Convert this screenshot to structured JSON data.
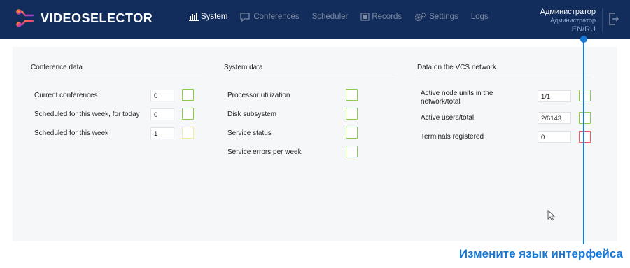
{
  "app": {
    "name": "VIDEOSELECTOR"
  },
  "nav": [
    {
      "label": "System",
      "icon": "bar-chart-icon",
      "active": true
    },
    {
      "label": "Conferences",
      "icon": "chat-bubble-icon"
    },
    {
      "label": "Scheduler",
      "icon": ""
    },
    {
      "label": "Records",
      "icon": "film-icon"
    },
    {
      "label": "Settings",
      "icon": "gears-icon"
    },
    {
      "label": "Logs",
      "icon": ""
    }
  ],
  "user": {
    "name": "Администратор",
    "role": "Администратор",
    "language": "EN/RU"
  },
  "conference_data": {
    "title": "Conference data",
    "rows": [
      {
        "label": "Current conferences",
        "value": "0",
        "status": "green"
      },
      {
        "label": "Scheduled for this week, for today",
        "value": "0",
        "status": "green"
      },
      {
        "label": "Scheduled for this week",
        "value": "1",
        "status": "yellow"
      }
    ]
  },
  "system_data": {
    "title": "System data",
    "rows": [
      {
        "label": "Processor utilization",
        "status": "green"
      },
      {
        "label": "Disk subsystem",
        "status": "green"
      },
      {
        "label": "Service status",
        "status": "green"
      },
      {
        "label": "Service errors per week",
        "status": "green"
      }
    ]
  },
  "vcs_network": {
    "title": "Data on the VCS network",
    "rows": [
      {
        "label_line1": "Active node units in the",
        "label_line2": "network/total",
        "value": "1/1",
        "status": "green"
      },
      {
        "label": "Active users/total",
        "value": "2/6143",
        "status": "green"
      },
      {
        "label": "Terminals registered",
        "value": "0",
        "status": "red"
      }
    ]
  },
  "callout": {
    "text": "Измените язык интерфейса",
    "color": "#1777d4"
  },
  "colors": {
    "header_bg": "#122d5b",
    "ok": "#8ccc4d",
    "warn": "#f1e99c",
    "error": "#ec5a5a"
  }
}
